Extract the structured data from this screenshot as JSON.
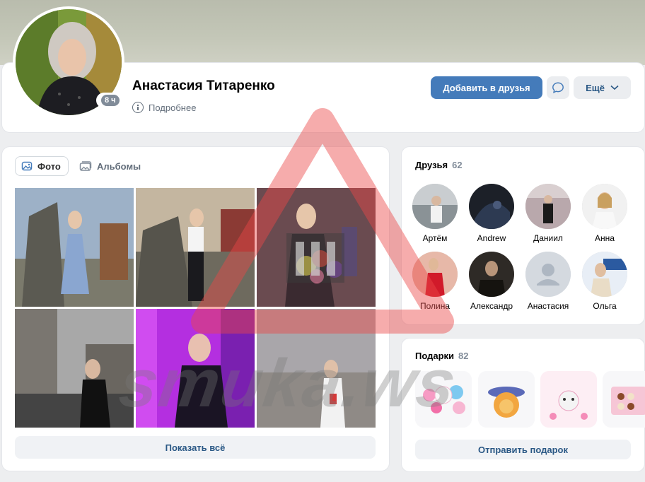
{
  "profile": {
    "name": "Анастасия Титаренко",
    "more_info": "Подробнее",
    "last_seen": "8 ч"
  },
  "actions": {
    "add_friend": "Добавить в друзья",
    "more": "Ещё"
  },
  "photos": {
    "tab_photos": "Фото",
    "tab_albums": "Альбомы",
    "show_all": "Показать всё"
  },
  "friends": {
    "title": "Друзья",
    "count": "62",
    "items": [
      {
        "name": "Артём"
      },
      {
        "name": "Andrew"
      },
      {
        "name": "Даниил"
      },
      {
        "name": "Анна"
      },
      {
        "name": "Полина"
      },
      {
        "name": "Александр"
      },
      {
        "name": "Анастасия"
      },
      {
        "name": "Ольга"
      }
    ]
  },
  "gifts": {
    "title": "Подарки",
    "count": "82",
    "send": "Отправить подарок"
  },
  "watermark": "smuka.ws",
  "colors": {
    "primary": "#447bba",
    "link": "#2a5885",
    "secondary_bg": "#ebedf0",
    "page_bg": "#edeef0"
  }
}
